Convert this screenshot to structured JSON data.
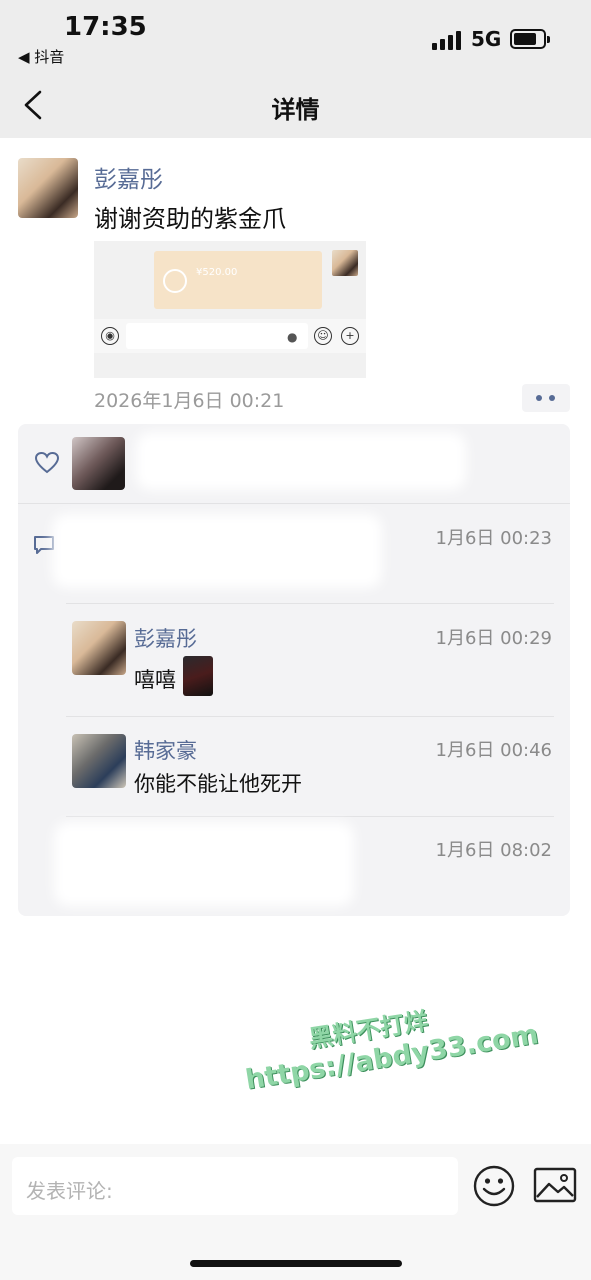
{
  "status_bar": {
    "time": "17:35",
    "back_app": "◀ 抖音",
    "network": "5G"
  },
  "nav": {
    "title": "详情",
    "back_icon": "chevron-left-icon"
  },
  "post": {
    "author": "彭嘉彤",
    "text": "谢谢资助的紫金爪",
    "image": {
      "amount": "¥520.00"
    },
    "date": "2026年1月6日 00:21",
    "more_icon": "more-dots-icon"
  },
  "interactions": {
    "like_icon": "heart-outline-icon",
    "comment_icon": "comment-bubble-icon",
    "comments": [
      {
        "time": "1月6日 00:23"
      },
      {
        "name": "彭嘉彤",
        "time": "1月6日 00:29",
        "text": "嘻嘻"
      },
      {
        "name": "韩家豪",
        "time": "1月6日 00:46",
        "text": "你能不能让他死开"
      },
      {
        "time": "1月6日 08:02"
      }
    ]
  },
  "watermark": {
    "line1": "黑料不打烊",
    "line2": "https://abdy33.com"
  },
  "bottom_bar": {
    "comment_placeholder": "发表评论:",
    "emoji_icon": "smiley-face-icon",
    "image_icon": "image-icon"
  },
  "colors": {
    "name_link": "#576b95",
    "panel_bg": "#f3f3f5",
    "header_bg": "#ededed"
  }
}
